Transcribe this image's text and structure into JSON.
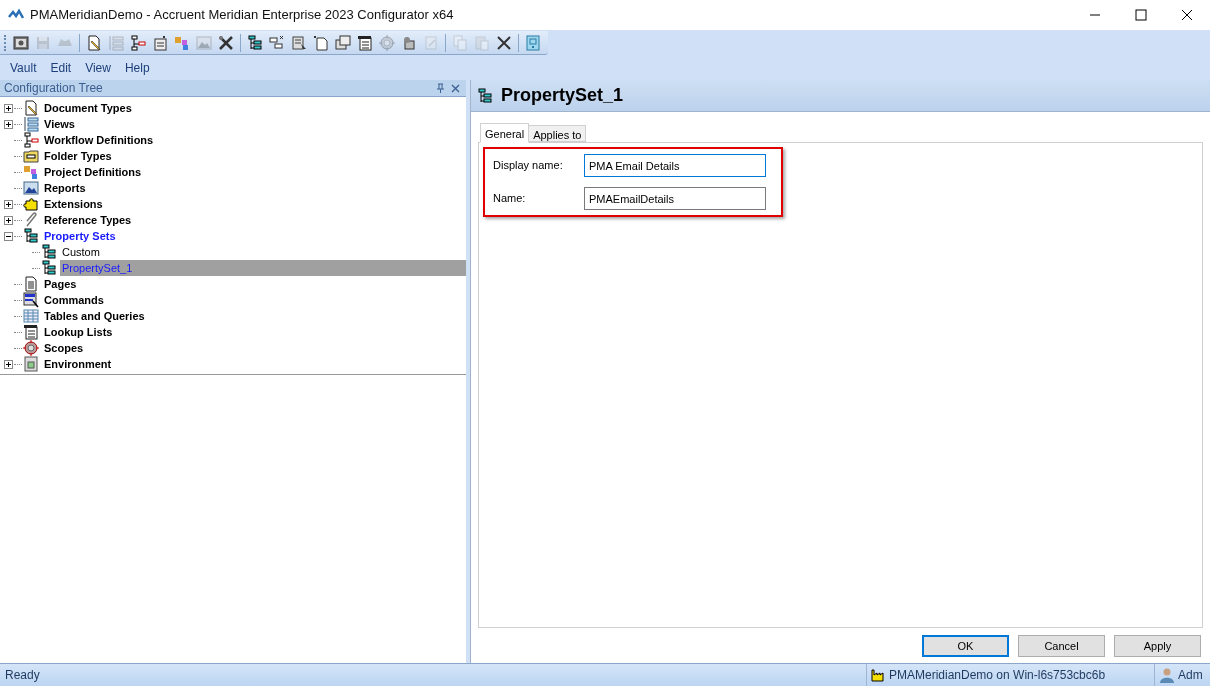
{
  "window": {
    "title": "PMAMeridianDemo - Accruent Meridian Enterprise 2023 Configurator x64"
  },
  "toolbar": {
    "groups": [
      {
        "buttons": [
          {
            "disabled": false
          },
          {
            "disabled": true
          },
          {
            "disabled": true
          }
        ]
      },
      {
        "buttons": [
          {
            "disabled": false
          },
          {
            "disabled": true
          },
          {
            "disabled": false
          },
          {
            "disabled": false
          },
          {
            "disabled": false
          },
          {
            "disabled": true
          },
          {
            "disabled": false
          }
        ]
      },
      {
        "buttons": [
          {
            "disabled": false
          },
          {
            "disabled": false
          },
          {
            "disabled": false
          },
          {
            "disabled": false
          },
          {
            "disabled": false
          },
          {
            "disabled": false
          },
          {
            "disabled": true
          },
          {
            "disabled": false
          },
          {
            "disabled": true
          }
        ]
      },
      {
        "buttons": [
          {
            "disabled": true
          },
          {
            "disabled": true
          },
          {
            "disabled": false
          }
        ]
      },
      {
        "buttons": [
          {
            "disabled": false
          }
        ]
      }
    ]
  },
  "menu": [
    "Vault",
    "Edit",
    "View",
    "Help"
  ],
  "tree_panel": {
    "title": "Configuration Tree",
    "items": [
      {
        "label": "Document Types",
        "expanded": false,
        "selected": false
      },
      {
        "label": "Views",
        "expanded": false,
        "selected": false
      },
      {
        "label": "Workflow Definitions",
        "selected": false
      },
      {
        "label": "Folder Types",
        "selected": false
      },
      {
        "label": "Project Definitions",
        "selected": false
      },
      {
        "label": "Reports",
        "selected": false
      },
      {
        "label": "Extensions",
        "expanded": false,
        "selected": false
      },
      {
        "label": "Reference Types",
        "expanded": false,
        "selected": false
      },
      {
        "label": "Property Sets",
        "expanded": true,
        "selected": false,
        "children": [
          {
            "label": "Custom",
            "selected": false
          },
          {
            "label": "PropertySet_1",
            "selected": true
          }
        ]
      },
      {
        "label": "Pages",
        "selected": false
      },
      {
        "label": "Commands",
        "selected": false
      },
      {
        "label": "Tables and Queries",
        "selected": false
      },
      {
        "label": "Lookup Lists",
        "selected": false
      },
      {
        "label": "Scopes",
        "selected": false
      },
      {
        "label": "Environment",
        "expanded": false,
        "selected": false
      }
    ]
  },
  "editor": {
    "title": "PropertySet_1",
    "tabs": [
      {
        "label": "General",
        "selected": true
      },
      {
        "label": "Applies to",
        "selected": false
      }
    ],
    "fields": [
      {
        "label": "Display name:",
        "value": "PMA Email Details",
        "focused": true
      },
      {
        "label": "Name:",
        "value": "PMAEmailDetails",
        "focused": false
      }
    ],
    "buttons": [
      {
        "label": "OK",
        "default": true
      },
      {
        "label": "Cancel",
        "default": false
      },
      {
        "label": "Apply",
        "default": false
      }
    ]
  },
  "status_bar": {
    "status": "Ready",
    "connection": "PMAMeridianDemo on Win-l6s753cbc6b",
    "user": "Adm"
  }
}
